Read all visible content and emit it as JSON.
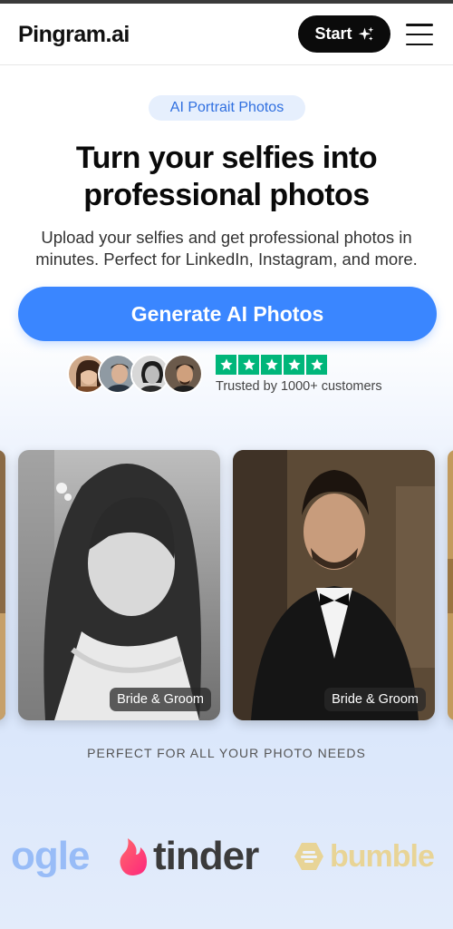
{
  "header": {
    "logo": "Pingram.ai",
    "start_label": "Start",
    "start_icon": "sparkles-icon",
    "menu_icon": "hamburger-menu-icon"
  },
  "hero": {
    "badge": "AI Portrait Photos",
    "headline_line1": "Turn your selfies into",
    "headline_line2": "professional photos",
    "subtext_line1": "Upload your selfies and get professional photos in",
    "subtext_line2": "minutes. Perfect for LinkedIn, Instagram, and more.",
    "cta_label": "Generate AI Photos",
    "cta_color": "#3a86ff"
  },
  "social_proof": {
    "rating": 5,
    "star_color": "#00b67a",
    "trusted_text": "Trusted by 1000+ customers"
  },
  "gallery": [
    {
      "label": "Bride & Groom"
    },
    {
      "label": "Bride & Groom"
    }
  ],
  "uses": {
    "title": "PERFECT FOR ALL YOUR PHOTO NEEDS",
    "brands": [
      "ogle",
      "tinder",
      "bumble"
    ]
  }
}
